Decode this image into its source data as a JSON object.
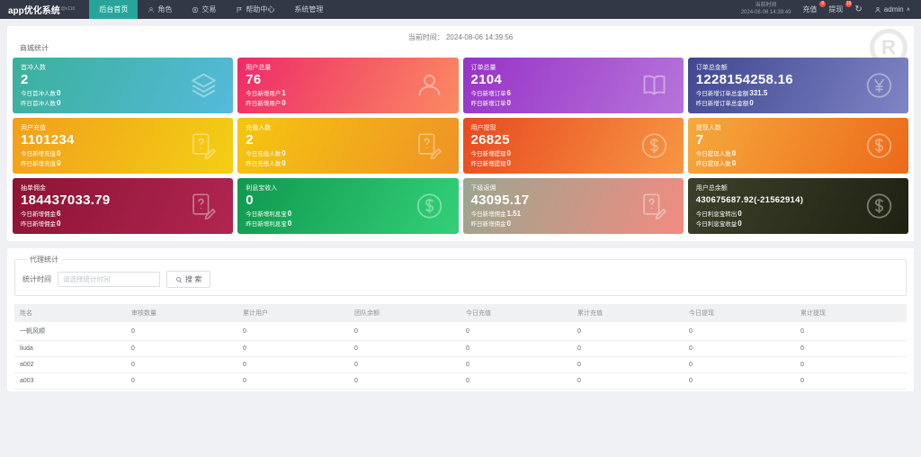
{
  "topbar": {
    "logo": "app优化系统",
    "logo_version": "@v110",
    "nav": [
      {
        "label": "后台首页",
        "icon": null,
        "active": true
      },
      {
        "label": "角色",
        "icon": "user",
        "active": false
      },
      {
        "label": "交易",
        "icon": "trade",
        "active": false
      },
      {
        "label": "帮助中心",
        "icon": "flag",
        "active": false
      },
      {
        "label": "系统管理",
        "icon": null,
        "active": false
      }
    ],
    "time_label": "当前时间",
    "time_value": "2024-08-06 14:39:49",
    "recharge": {
      "label": "充值",
      "badge": "0"
    },
    "withdraw": {
      "label": "提现",
      "badge": "19"
    },
    "refresh_icon": "↻",
    "username": "admin",
    "chevron": "∧"
  },
  "stats_panel": {
    "time_label": "当前时间：",
    "time_value": "2024-08-06 14:39:56",
    "title": "商城统计",
    "watermark_letter": "R",
    "cards": [
      {
        "title": "首冲人数",
        "value": "2",
        "line1_label": "今日首冲人数",
        "line1_value": "0",
        "line2_label": "昨日首冲人数",
        "line2_value": "0",
        "icon": "layers",
        "gradient": [
          "#3cb09b",
          "#54bada"
        ]
      },
      {
        "title": "用户总量",
        "value": "76",
        "line1_label": "今日新增用户",
        "line1_value": "1",
        "line2_label": "昨日新增用户",
        "line2_value": "0",
        "icon": "user",
        "gradient": [
          "#ee2b69",
          "#fb8a61"
        ]
      },
      {
        "title": "订单总量",
        "value": "2104",
        "line1_label": "今日新增订单",
        "line1_value": "6",
        "line2_label": "昨日新增订单",
        "line2_value": "0",
        "icon": "book",
        "gradient": [
          "#9733c8",
          "#b673da"
        ]
      },
      {
        "title": "订单总金额",
        "value": "1228154258.16",
        "line1_label": "今日新增订单总金额",
        "line1_value": "331.5",
        "line2_label": "昨日新增订单总金额",
        "line2_value": "0",
        "icon": "yen-circle",
        "gradient": [
          "#414791",
          "#7e84c4"
        ]
      },
      {
        "title": "用户充值",
        "value": "1101234",
        "line1_label": "今日新增充值",
        "line1_value": "0",
        "line2_label": "昨日新增充值",
        "line2_value": "0",
        "icon": "file-question",
        "gradient": [
          "#f29f1c",
          "#f3cf13"
        ]
      },
      {
        "title": "充值人数",
        "value": "2",
        "line1_label": "今日充值人数",
        "line1_value": "0",
        "line2_label": "昨日充值人数",
        "line2_value": "0",
        "icon": "file-question",
        "gradient": [
          "#f5c60f",
          "#ef9226"
        ]
      },
      {
        "title": "用户提现",
        "value": "26825",
        "line1_label": "今日新增提现",
        "line1_value": "0",
        "line2_label": "昨日新增提现",
        "line2_value": "0",
        "icon": "dollar-circle",
        "gradient": [
          "#e84a20",
          "#f79643"
        ]
      },
      {
        "title": "提现人数",
        "value": "7",
        "line1_label": "今日提现人数",
        "line1_value": "0",
        "line2_label": "昨日提现人数",
        "line2_value": "0",
        "icon": "dollar-circle",
        "gradient": [
          "#f6a93c",
          "#ec6a1a"
        ]
      },
      {
        "title": "抽单佣金",
        "value": "184437033.79",
        "line1_label": "今日新增佣金",
        "line1_value": "6",
        "line2_label": "昨日新增佣金",
        "line2_value": "0",
        "icon": "file-question",
        "gradient": [
          "#8c1434",
          "#b12551"
        ]
      },
      {
        "title": "利息宝收入",
        "value": "0",
        "line1_label": "今日新增利息宝",
        "line1_value": "0",
        "line2_label": "昨日新增利息宝",
        "line2_value": "0",
        "icon": "dollar-circle",
        "gradient": [
          "#10994f",
          "#33d078"
        ]
      },
      {
        "title": "下级返佣",
        "value": "43095.17",
        "line1_label": "今日新增佣金",
        "line1_value": "1.51",
        "line2_label": "昨日新增佣金",
        "line2_value": "0",
        "icon": "file-question",
        "gradient": [
          "#9ba68e",
          "#f28b81"
        ]
      },
      {
        "title": "用户总余额",
        "value": "430675687.92(-21562914)",
        "line1_label": "今日利息宝转出",
        "line1_value": "0",
        "line2_label": "今日利息宝收益",
        "line2_value": "0",
        "icon": "dollar-circle",
        "gradient": [
          "#3d402a",
          "#1f2212"
        ]
      }
    ]
  },
  "agent_panel": {
    "title": "代理统计",
    "filter_label": "统计时间",
    "filter_placeholder": "请选择统计时间",
    "search_label": "搜 索",
    "headers": [
      "姓名",
      "审核数量",
      "累计用户",
      "团队余额",
      "今日充值",
      "累计充值",
      "今日提现",
      "累计提现"
    ],
    "rows": [
      [
        "一帆风顺",
        "0",
        "0",
        "0",
        "0",
        "0",
        "0",
        "0"
      ],
      [
        "liuda",
        "0",
        "0",
        "0",
        "0",
        "0",
        "0",
        "0"
      ],
      [
        "a002",
        "0",
        "0",
        "0",
        "0",
        "0",
        "0",
        "0"
      ],
      [
        "a003",
        "0",
        "0",
        "0",
        "0",
        "0",
        "0",
        "0"
      ]
    ]
  },
  "colors": {
    "accent": "#26a69a",
    "badge": "#f4503a",
    "topbar": "#333846"
  }
}
